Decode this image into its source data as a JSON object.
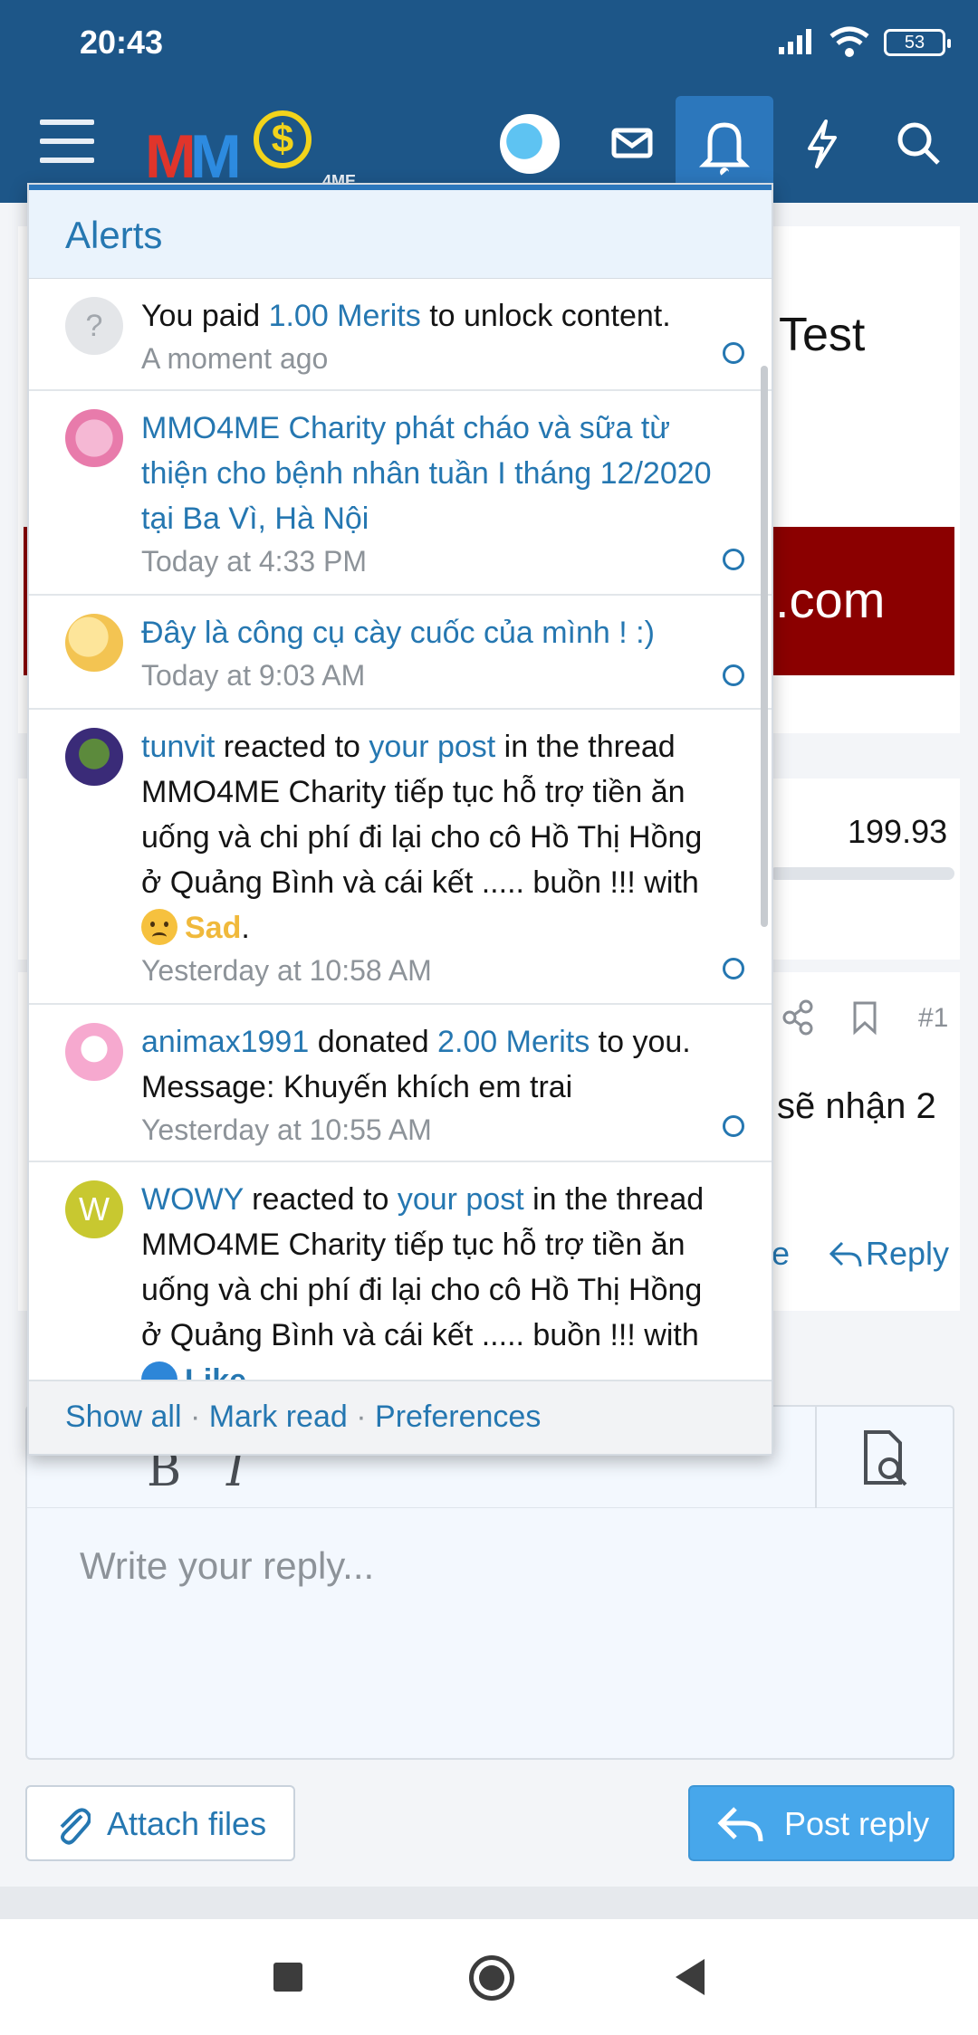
{
  "status_bar": {
    "time": "20:43",
    "battery": "53"
  },
  "header": {
    "logo_text_1": "MM",
    "logo_text_2": "$",
    "logo_suffix": "4ME"
  },
  "background": {
    "thread_title_tail": "Test",
    "banner_text": ".com",
    "value": "199.93",
    "post_number": "#1",
    "post_text": "sẽ nhận 2",
    "partial_link": "e",
    "reply_label": "Reply",
    "editor_placeholder": "Write your reply...",
    "attach_label": "Attach files",
    "post_reply_label": "Post reply"
  },
  "alerts_popup": {
    "title": "Alerts",
    "items": [
      {
        "pre": "You paid ",
        "link": "1.00 Merits",
        "post": " to unlock content.",
        "time": "A moment ago",
        "avatar": "?"
      },
      {
        "title": "MMO4ME Charity phát cháo và sữa từ thiện cho bệnh nhân tuần I tháng 12/2020 tại Ba Vì, Hà Nội",
        "time": "Today at 4:33 PM"
      },
      {
        "title": "Đây là công cụ cày cuốc của mình ! :)",
        "time": "Today at 9:03 AM"
      },
      {
        "user": "tunvit",
        "mid1": " reacted to ",
        "link": "your post",
        "mid2": " in the thread MMO4ME Charity tiếp tục hỗ trợ tiền ăn uống và chi phí đi lại cho cô Hồ Thị Hồng ở Quảng Bình và cái kết ..... buồn !!! with ",
        "reaction": "Sad",
        "end": ".",
        "time": "Yesterday at 10:58 AM"
      },
      {
        "user": "animax1991",
        "mid1": " donated ",
        "link": "2.00 Merits",
        "mid2": " to you. Message: Khuyến khích em trai",
        "time": "Yesterday at 10:55 AM"
      },
      {
        "user": "WOWY",
        "mid1": " reacted to ",
        "link": "your post",
        "mid2": " in the thread MMO4ME Charity tiếp tục hỗ trợ tiền ăn uống và chi phí đi lại cho cô Hồ Thị Hồng ở Quảng Bình và cái kết ..... buồn !!! with ",
        "reaction": "Like",
        "avatar": "W"
      }
    ],
    "footer": {
      "show_all": "Show all",
      "sep": " · ",
      "mark_read": "Mark read",
      "preferences": "Preferences"
    }
  },
  "colors": {
    "header": "#1d5688",
    "link": "#2577b1",
    "post_button": "#47a7eb"
  }
}
